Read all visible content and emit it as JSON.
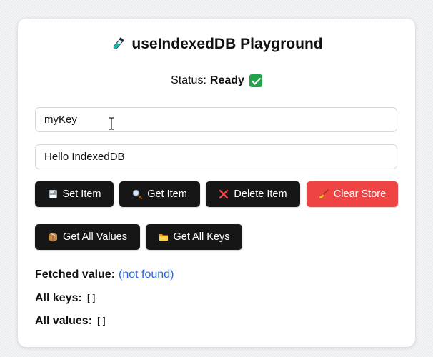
{
  "title": "useIndexedDB Playground",
  "status": {
    "label": "Status:",
    "value": "Ready",
    "icon": "check-mark-icon"
  },
  "inputs": {
    "key_value": "myKey",
    "value_value": "Hello IndexedDB"
  },
  "buttons": {
    "set_item": "Set Item",
    "get_item": "Get Item",
    "delete_item": "Delete Item",
    "clear_store": "Clear Store",
    "get_all_values": "Get All Values",
    "get_all_keys": "Get All Keys"
  },
  "results": {
    "fetched_label": "Fetched value:",
    "fetched_value": "(not found)",
    "keys_label": "All keys:",
    "keys_value": "[]",
    "values_label": "All values:",
    "values_value": "[]"
  },
  "colors": {
    "primary_button": "#161616",
    "danger_button": "#ef4444",
    "not_found_text": "#2563eb",
    "status_check": "#22a34a"
  }
}
